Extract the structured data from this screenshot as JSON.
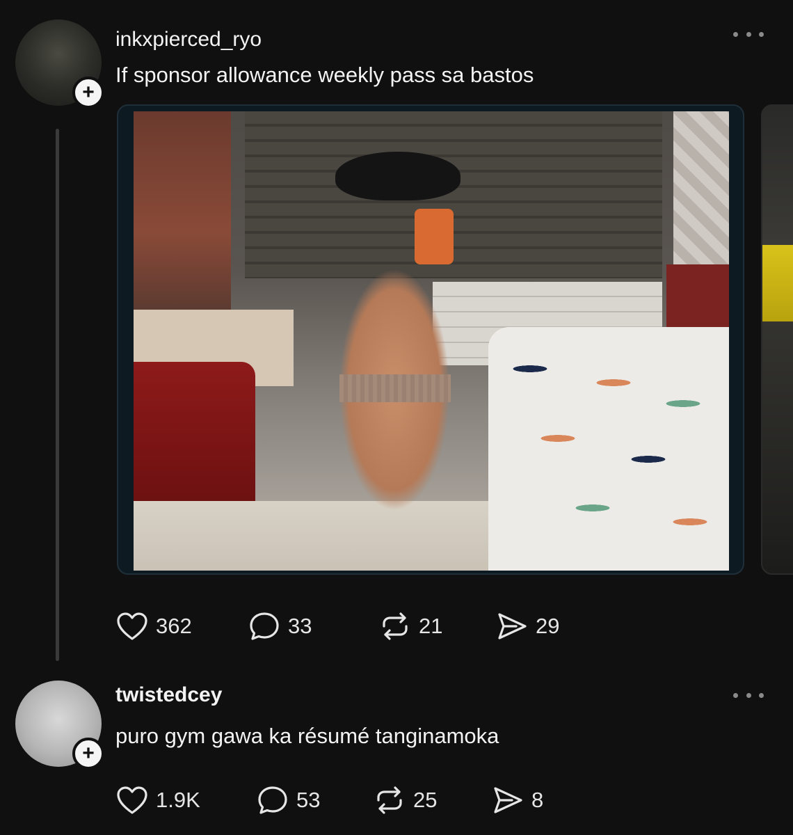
{
  "posts": [
    {
      "username": "inkxpierced_ryo",
      "text": "If sponsor allowance weekly pass sa bastos",
      "stats": {
        "likes": "362",
        "replies": "33",
        "reposts": "21",
        "shares": "29"
      }
    },
    {
      "username": "twistedcey",
      "text": "puro gym gawa ka résumé tanginamoka",
      "stats": {
        "likes": "1.9K",
        "replies": "53",
        "reposts": "25",
        "shares": "8"
      }
    }
  ],
  "icons": {
    "follow": "plus-icon",
    "more": "more-options-icon",
    "like": "heart-icon",
    "reply": "comment-icon",
    "repost": "repost-icon",
    "share": "share-icon"
  },
  "badge_glyph": "+",
  "colors": {
    "background": "#101010",
    "text": "#f3f3f3",
    "muted": "#8a8a8a",
    "thread_line": "#3a3a3a"
  }
}
